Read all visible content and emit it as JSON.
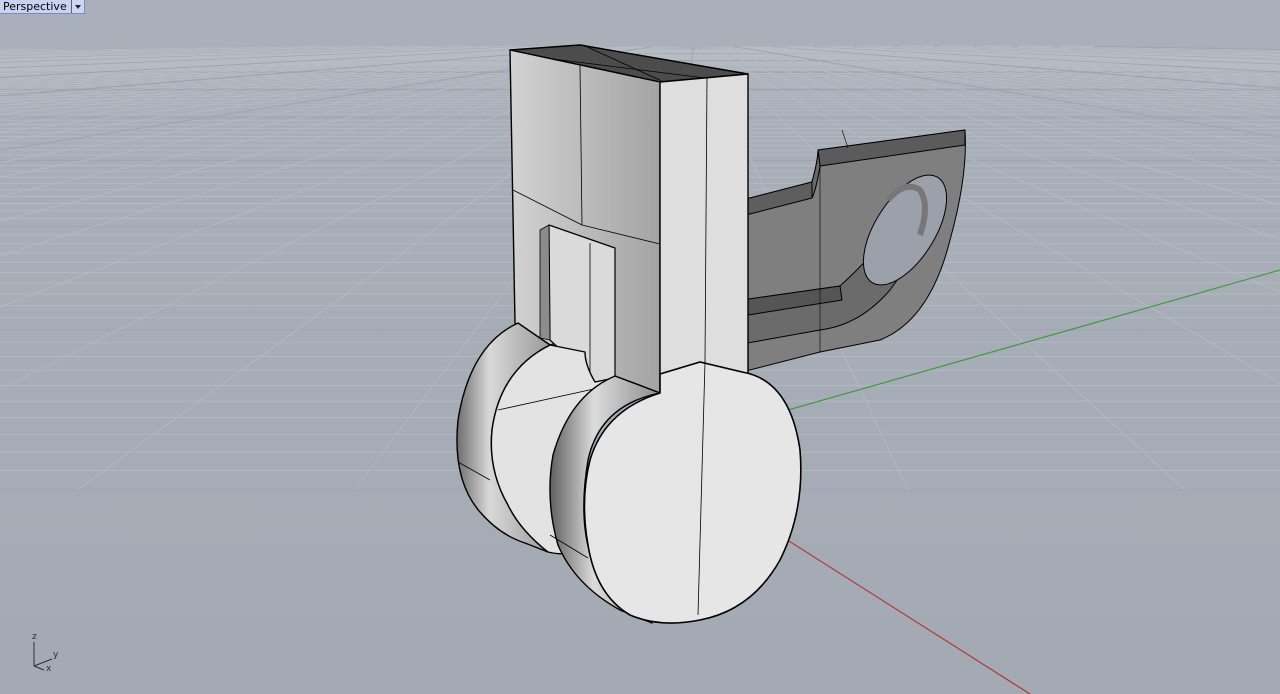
{
  "viewport": {
    "title": "Perspective",
    "dropdown_icon": "chevron-down-icon",
    "background_color": "#a6adb6",
    "grid_minor_color": "#b7bdc5",
    "grid_major_color": "#9da4ae",
    "x_axis_color": "#b03a3a",
    "y_axis_color": "#3f9a3f",
    "projection": "perspective"
  },
  "axis_indicator": {
    "z_label": "z",
    "y_label": "y",
    "x_label": "x"
  },
  "model": {
    "shading": "shaded",
    "face_light": "#e2e2e2",
    "face_mid": "#c8c8c8",
    "face_dark": "#7e7e7e",
    "edge_color": "#000000"
  }
}
